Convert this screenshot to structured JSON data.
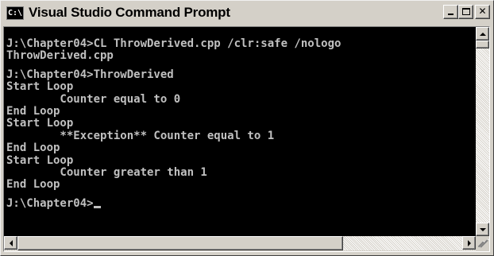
{
  "window": {
    "title": "Visual Studio Command Prompt",
    "icon": "console-icon",
    "icon_text": "C:\\"
  },
  "caption_buttons": {
    "minimize_icon": "minimize-icon",
    "maximize_icon": "maximize-icon",
    "close_icon": "close-icon",
    "close_glyph": "✕"
  },
  "console": {
    "lines": [
      "J:\\Chapter04>CL ThrowDerived.cpp /clr:safe /nologo",
      "ThrowDerived.cpp",
      "",
      "J:\\Chapter04>ThrowDerived",
      "Start Loop",
      "        Counter equal to 0",
      "End Loop",
      "Start Loop",
      "        **Exception** Counter equal to 1",
      "End Loop",
      "Start Loop",
      "        Counter greater than 1",
      "End Loop",
      "",
      "J:\\Chapter04>"
    ],
    "colors": {
      "background": "#000000",
      "text": "#c0c0c0"
    }
  },
  "scrollbars": {
    "vertical": {
      "up_icon": "arrow-up-icon",
      "down_icon": "arrow-down-icon"
    },
    "horizontal": {
      "left_icon": "arrow-left-icon",
      "right_icon": "arrow-right-icon"
    }
  }
}
